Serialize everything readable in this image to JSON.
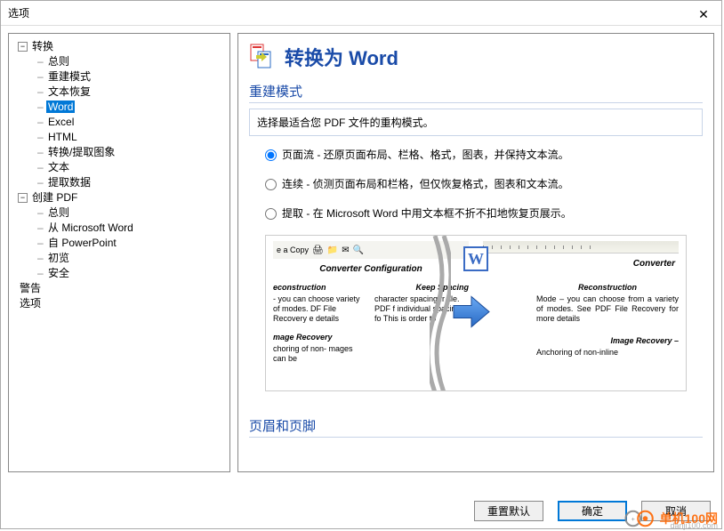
{
  "window": {
    "title": "选项"
  },
  "tree": [
    {
      "label": "转换",
      "level": 0,
      "expanded": true
    },
    {
      "label": "总则",
      "level": 1
    },
    {
      "label": "重建模式",
      "level": 1
    },
    {
      "label": "文本恢复",
      "level": 1
    },
    {
      "label": "Word",
      "level": 1,
      "selected": true
    },
    {
      "label": "Excel",
      "level": 1
    },
    {
      "label": "HTML",
      "level": 1
    },
    {
      "label": "转换/提取图象",
      "level": 1
    },
    {
      "label": "文本",
      "level": 1
    },
    {
      "label": "提取数据",
      "level": 1
    },
    {
      "label": "创建 PDF",
      "level": 0,
      "expanded": true
    },
    {
      "label": "总则",
      "level": 1
    },
    {
      "label": "从 Microsoft Word",
      "level": 1
    },
    {
      "label": "自 PowerPoint",
      "level": 1
    },
    {
      "label": "初览",
      "level": 1
    },
    {
      "label": "安全",
      "level": 1
    },
    {
      "label": "警告",
      "level": 0,
      "leaf": true
    },
    {
      "label": "选项",
      "level": 0,
      "leaf": true
    }
  ],
  "page": {
    "heading": "转换为 Word",
    "section1_title": "重建模式",
    "section1_desc": "选择最适合您 PDF 文件的重构模式。",
    "radios": [
      {
        "label": "页面流 - 还原页面布局、栏格、格式，图表，并保持文本流。",
        "checked": true
      },
      {
        "label": "连续 - 侦测页面布局和栏格，但仅恢复格式，图表和文本流。",
        "checked": false
      },
      {
        "label": "提取 - 在 Microsoft Word 中用文本框不折不扣地恢复页展示。",
        "checked": false
      }
    ],
    "section2_title": "页眉和页脚",
    "preview": {
      "left_toolbar": "e a Copy",
      "left_title": "Converter Configuration",
      "left_col1_h": "econstruction",
      "left_col1_p": "- you can choose variety of modes. DF File Recovery e details",
      "left_col2_h": "Keep Spacing",
      "left_col2_p": "character spacing fr file. PDF f individual spacing fo This is order to",
      "left_imgrec_h": "mage Recovery",
      "left_imgrec_p": "choring of non- mages can be",
      "right_title": "Converter",
      "right_h": "Reconstruction",
      "right_p": "Mode – you can choose from a variety of modes. See PDF File Recovery for more details",
      "right_imgrec_h": "Image Recovery –",
      "right_imgrec_p": "Anchoring of non-inline"
    }
  },
  "buttons": {
    "reset": "重置默认",
    "ok": "确定",
    "cancel": "取消"
  },
  "watermark": "danji100.com"
}
